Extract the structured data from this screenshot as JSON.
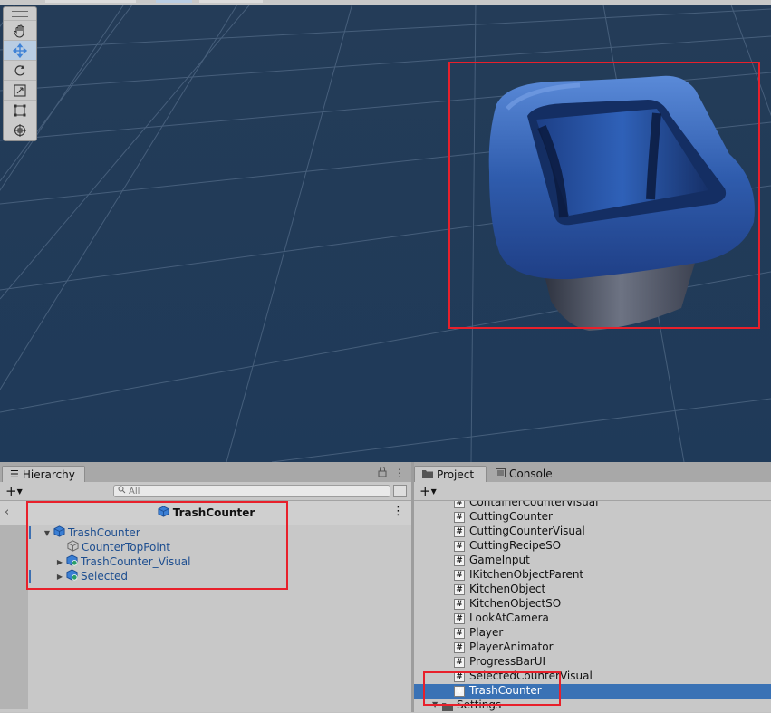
{
  "hierarchy": {
    "tab_label": "Hierarchy",
    "search_placeholder": "All",
    "prefab_title": "TrashCounter",
    "tree": [
      {
        "label": "TrashCounter",
        "icon": "prefab-cube-icon"
      },
      {
        "label": "CounterTopPoint",
        "icon": "gameobject-icon"
      },
      {
        "label": "TrashCounter_Visual",
        "icon": "prefab-icon"
      },
      {
        "label": "Selected",
        "icon": "prefab-icon"
      }
    ]
  },
  "project": {
    "tabs": [
      "Project",
      "Console"
    ],
    "scripts": [
      "ContainerCounterVisual",
      "CuttingCounter",
      "CuttingCounterVisual",
      "CuttingRecipeSO",
      "GameInput",
      "IKitchenObjectParent",
      "KitchenObject",
      "KitchenObjectSO",
      "LookAtCamera",
      "Player",
      "PlayerAnimator",
      "ProgressBarUI",
      "SelectedCounterVisual",
      "TrashCounter"
    ],
    "selected": "TrashCounter",
    "partial_folder": "Settings"
  },
  "scene_tools": [
    "hand-tool",
    "move-tool",
    "rotate-tool",
    "scale-tool",
    "rect-tool",
    "transform-tool"
  ],
  "colors": {
    "scene_background": "#1f3a59",
    "selection": "#3a72b5",
    "annotation": "#e8202b",
    "trash_can_rim": "#2f5cad"
  }
}
